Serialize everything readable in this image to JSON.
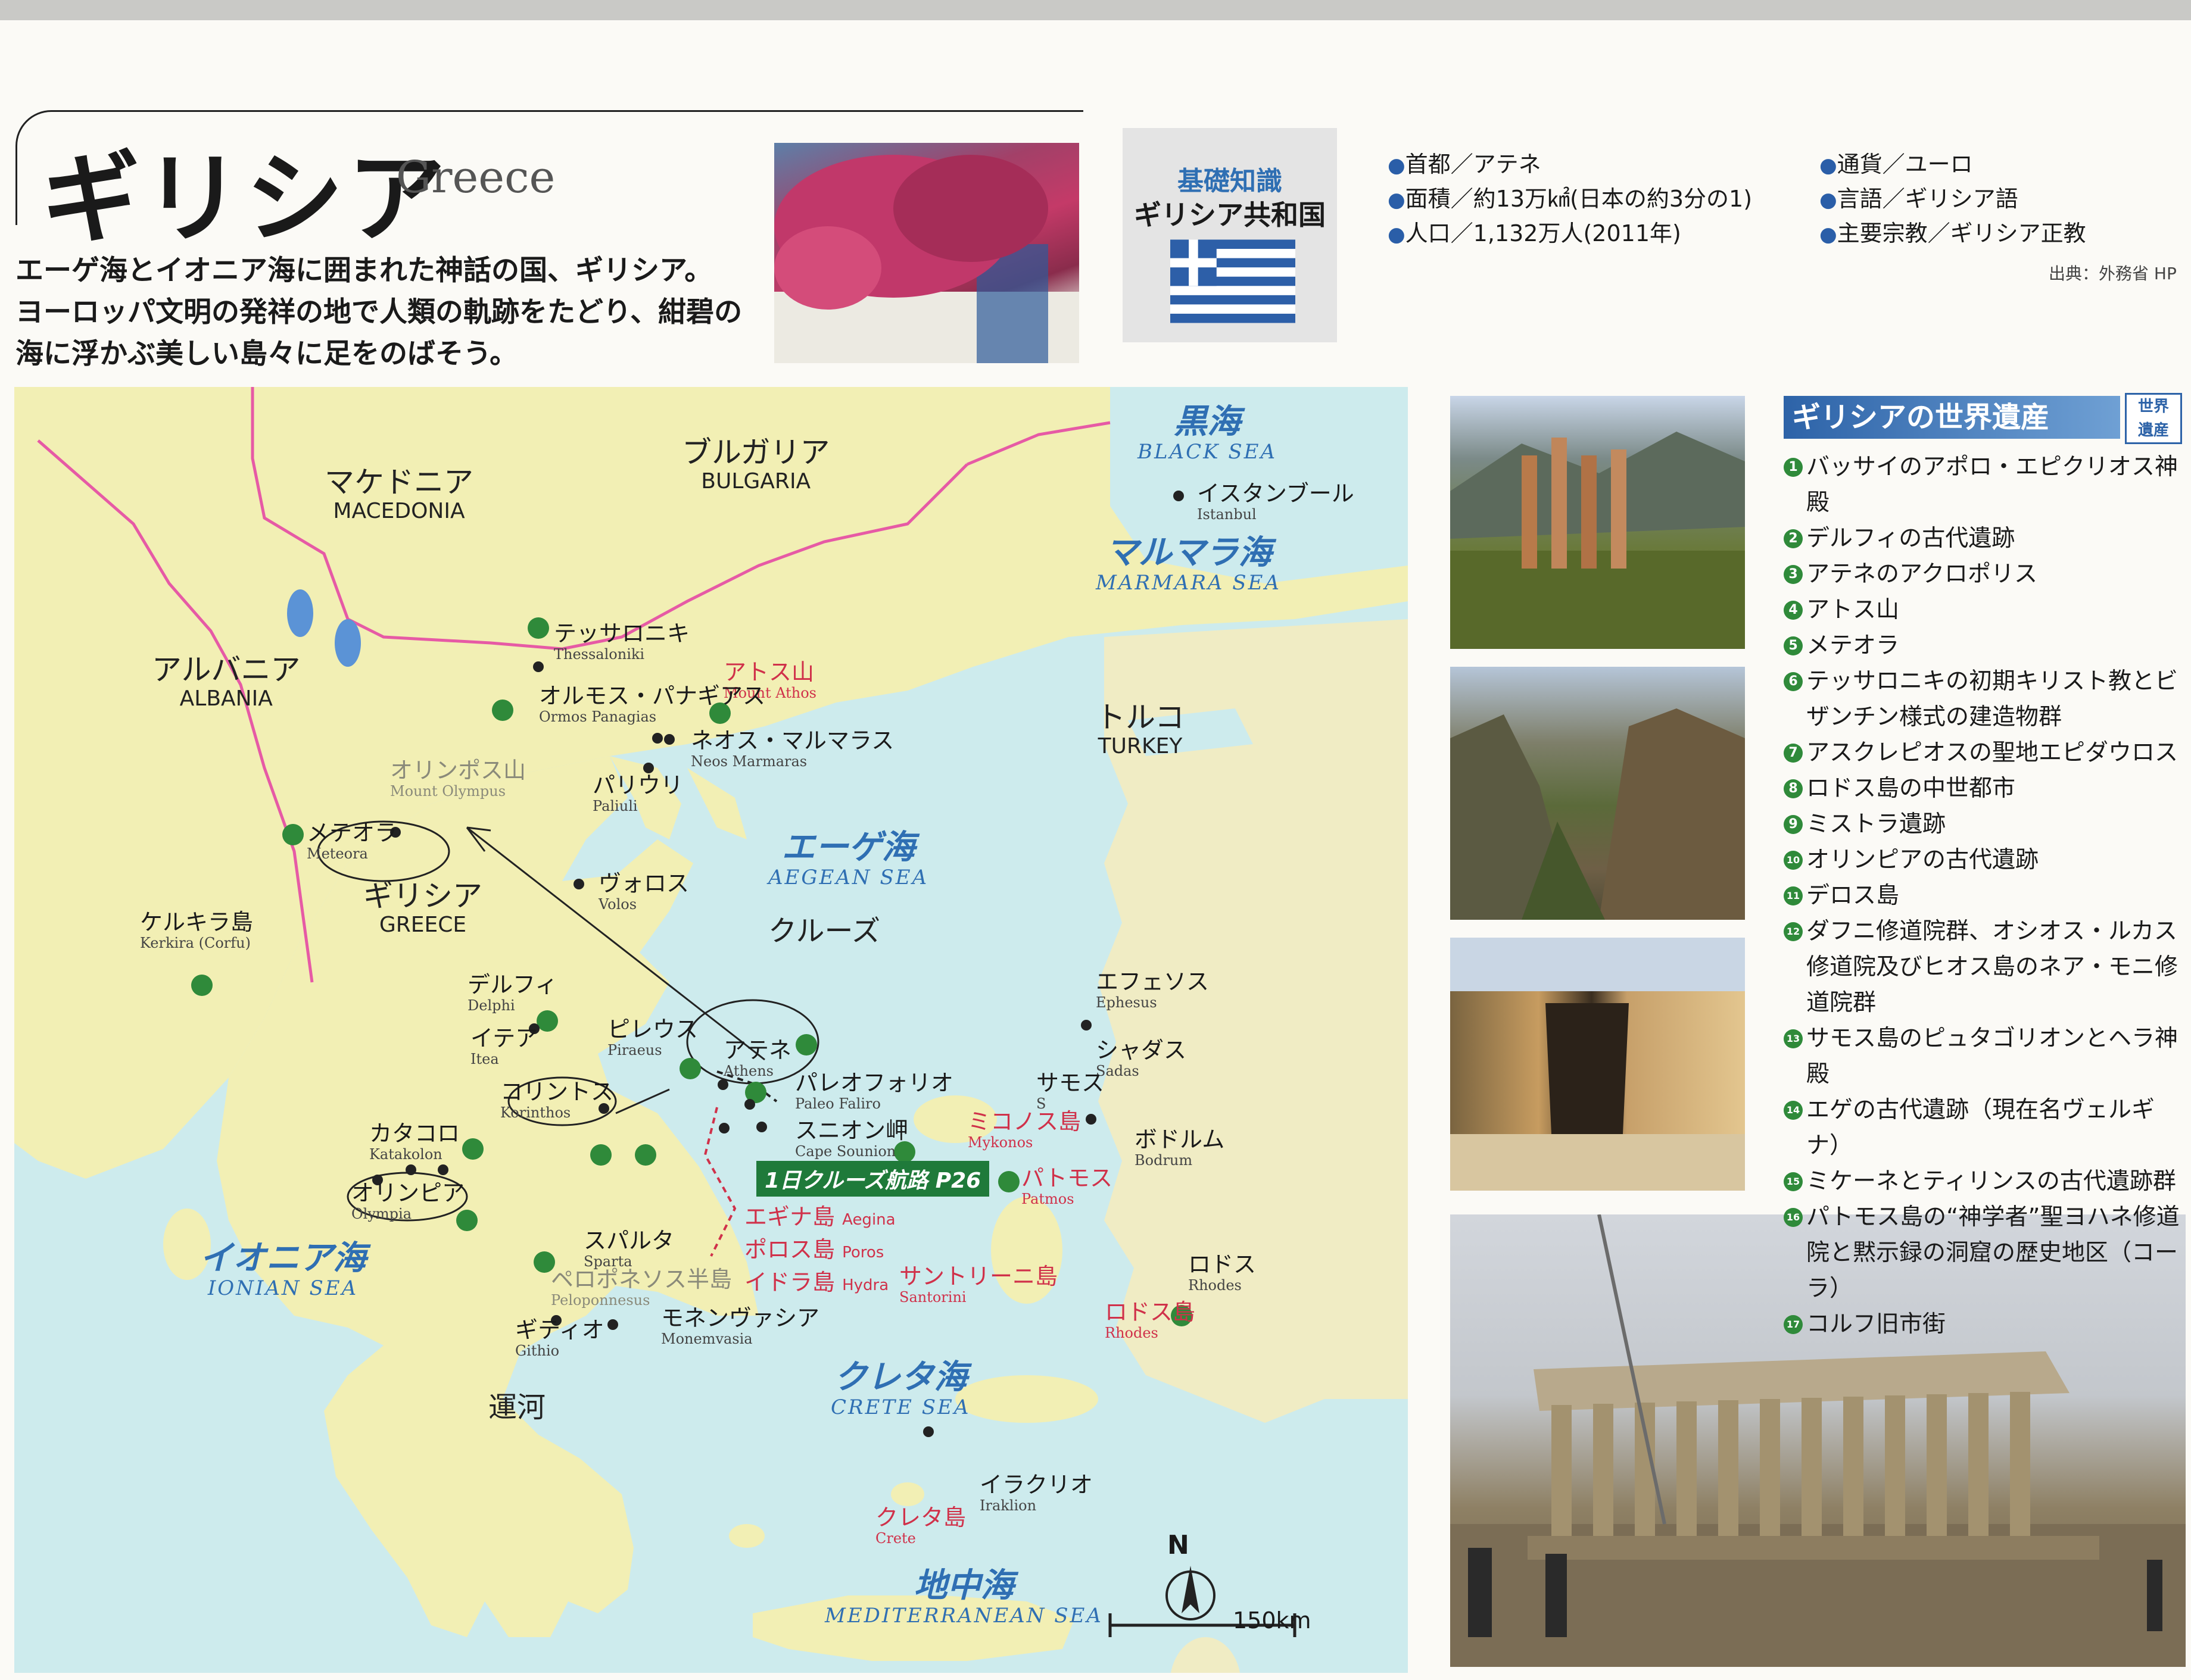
{
  "header": {
    "title_jp": "ギリシア",
    "title_en": "Greece",
    "intro": [
      "エーゲ海とイオニア海に囲まれた神話の国、ギリシア。",
      "ヨーロッパ文明の発祥の地で人類の軌跡をたどり、紺碧の",
      "海に浮かぶ美しい島々に足をのばそう。"
    ]
  },
  "basic_info": {
    "label": "基礎知識",
    "country": "ギリシア共和国",
    "flag_colors": {
      "blue": "#2d5fa8",
      "white": "#ffffff"
    },
    "items_left": [
      "首都／アテネ",
      "面積／約13万㎢(日本の約3分の1)",
      "人口／1,132万人(2011年)"
    ],
    "items_right": [
      "通貨／ユーロ",
      "言語／ギリシア語",
      "主要宗教／ギリシア正教"
    ],
    "source": "出典：外務省 HP"
  },
  "world_heritage": {
    "title": "ギリシアの世界遺産",
    "badge": [
      "世界",
      "遺産"
    ],
    "items": [
      {
        "n": "1",
        "label": "バッサイのアポロ・エピクリオス神殿"
      },
      {
        "n": "2",
        "label": "デルフィの古代遺跡"
      },
      {
        "n": "3",
        "label": "アテネのアクロポリス"
      },
      {
        "n": "4",
        "label": "アトス山"
      },
      {
        "n": "5",
        "label": "メテオラ"
      },
      {
        "n": "6",
        "label": "テッサロニキの初期キリスト教とビザンチン様式の建造物群"
      },
      {
        "n": "7",
        "label": "アスクレピオスの聖地エピダウロス"
      },
      {
        "n": "8",
        "label": "ロドス島の中世都市"
      },
      {
        "n": "9",
        "label": "ミストラ遺跡"
      },
      {
        "n": "10",
        "label": "オリンピアの古代遺跡"
      },
      {
        "n": "11",
        "label": "デロス島"
      },
      {
        "n": "12",
        "label": "ダフニ修道院群、オシオス・ルカス修道院及びヒオス島のネア・モニ修道院群"
      },
      {
        "n": "13",
        "label": "サモス島のピュタゴリオンとヘラ神殿"
      },
      {
        "n": "14",
        "label": "エゲの古代遺跡（現在名ヴェルギナ）"
      },
      {
        "n": "15",
        "label": "ミケーネとティリンスの古代遺跡群"
      },
      {
        "n": "16",
        "label": "パトモス島の“神学者”聖ヨハネ修道院と黙示録の洞窟の歴史地区（コーラ）"
      },
      {
        "n": "17",
        "label": "コルフ旧市街"
      }
    ]
  },
  "map": {
    "colors": {
      "sea": "#cdebed",
      "land": "#f2efb4",
      "turkey": "#f0ecc4",
      "border": "#e65aa5",
      "sea_text": "#2f6fb3",
      "red_text": "#d0314a",
      "site": "#2f8a3a"
    },
    "countries": [
      {
        "jp": "マケドニア",
        "en": "MACEDONIA"
      },
      {
        "jp": "ブルガリア",
        "en": "BULGARIA"
      },
      {
        "jp": "アルバニア",
        "en": "ALBANIA"
      },
      {
        "jp": "トルコ",
        "en": "TURKEY"
      },
      {
        "jp": "ギリシア",
        "en": "GREECE"
      }
    ],
    "seas": [
      {
        "jp": "黒海",
        "en": "BLACK SEA"
      },
      {
        "jp": "マルマラ海",
        "en": "MARMARA SEA"
      },
      {
        "jp": "エーゲ海",
        "en": "AEGEAN SEA"
      },
      {
        "jp": "イオニア海",
        "en": "IONIAN SEA"
      },
      {
        "jp": "クレタ海",
        "en": "CRETE SEA"
      },
      {
        "jp": "地中海",
        "en": "MEDITERRANEAN SEA"
      }
    ],
    "cities": [
      {
        "jp": "イスタンブール",
        "en": "Istanbul"
      },
      {
        "jp": "テッサロニキ",
        "en": "Thessaloniki"
      },
      {
        "jp": "アトス山",
        "en": "Mount Athos"
      },
      {
        "jp": "オルモス・パナギアス",
        "en": "Ormos Panagias"
      },
      {
        "jp": "ネオス・マルマラス",
        "en": "Neos Marmaras"
      },
      {
        "jp": "パリウリ",
        "en": "Paliuli"
      },
      {
        "jp": "オリンポス山",
        "en": "Mount Olympus"
      },
      {
        "jp": "メテオラ",
        "en": "Meteora"
      },
      {
        "jp": "ヴォロス",
        "en": "Volos"
      },
      {
        "jp": "ケルキラ島",
        "en": "Kerkira (Corfu)"
      },
      {
        "jp": "デルフィ",
        "en": "Delphi"
      },
      {
        "jp": "イテア",
        "en": "Itea"
      },
      {
        "jp": "ピレウス",
        "en": "Piraeus"
      },
      {
        "jp": "アテネ",
        "en": "Athens"
      },
      {
        "jp": "パレオフォリオ",
        "en": "Paleo Faliro"
      },
      {
        "jp": "スニオン岬",
        "en": "Cape Sounion"
      },
      {
        "jp": "コリントス",
        "en": "Korinthos"
      },
      {
        "jp": "カタコロ",
        "en": "Katakolon"
      },
      {
        "jp": "オリンピア",
        "en": "Olympia"
      },
      {
        "jp": "スパルタ",
        "en": "Sparta"
      },
      {
        "jp": "ペロポネソス半島",
        "en": "Peloponnesus"
      },
      {
        "jp": "ギティオ",
        "en": "Githio"
      },
      {
        "jp": "モネンヴァシア",
        "en": "Monemvasia"
      },
      {
        "jp": "エフェソス",
        "en": "Ephesus"
      },
      {
        "jp": "シャダス",
        "en": "Sadas"
      },
      {
        "jp": "サモス",
        "en": "S"
      },
      {
        "jp": "ボドルム",
        "en": "Bodrum"
      },
      {
        "jp": "ロドス",
        "en": "Rhodes"
      },
      {
        "jp": "ロドス島",
        "en": "Rhodes"
      },
      {
        "jp": "イラクリオ",
        "en": "Iraklion"
      },
      {
        "jp": "クレタ島",
        "en": "Crete"
      }
    ],
    "islands_red": [
      {
        "jp": "ミコノス島",
        "en": "Mykonos"
      },
      {
        "jp": "パトモス",
        "en": "Patmos"
      },
      {
        "jp": "エギナ島",
        "en": "Aegina"
      },
      {
        "jp": "ポロス島",
        "en": "Poros"
      },
      {
        "jp": "イドラ島",
        "en": "Hydra"
      },
      {
        "jp": "サントリーニ島",
        "en": "Santorini"
      }
    ],
    "cruise_label": "1日クルーズ航路 P26",
    "handwriting": [
      "クルーズ",
      "運河"
    ],
    "scale": "150km",
    "north": "N"
  }
}
